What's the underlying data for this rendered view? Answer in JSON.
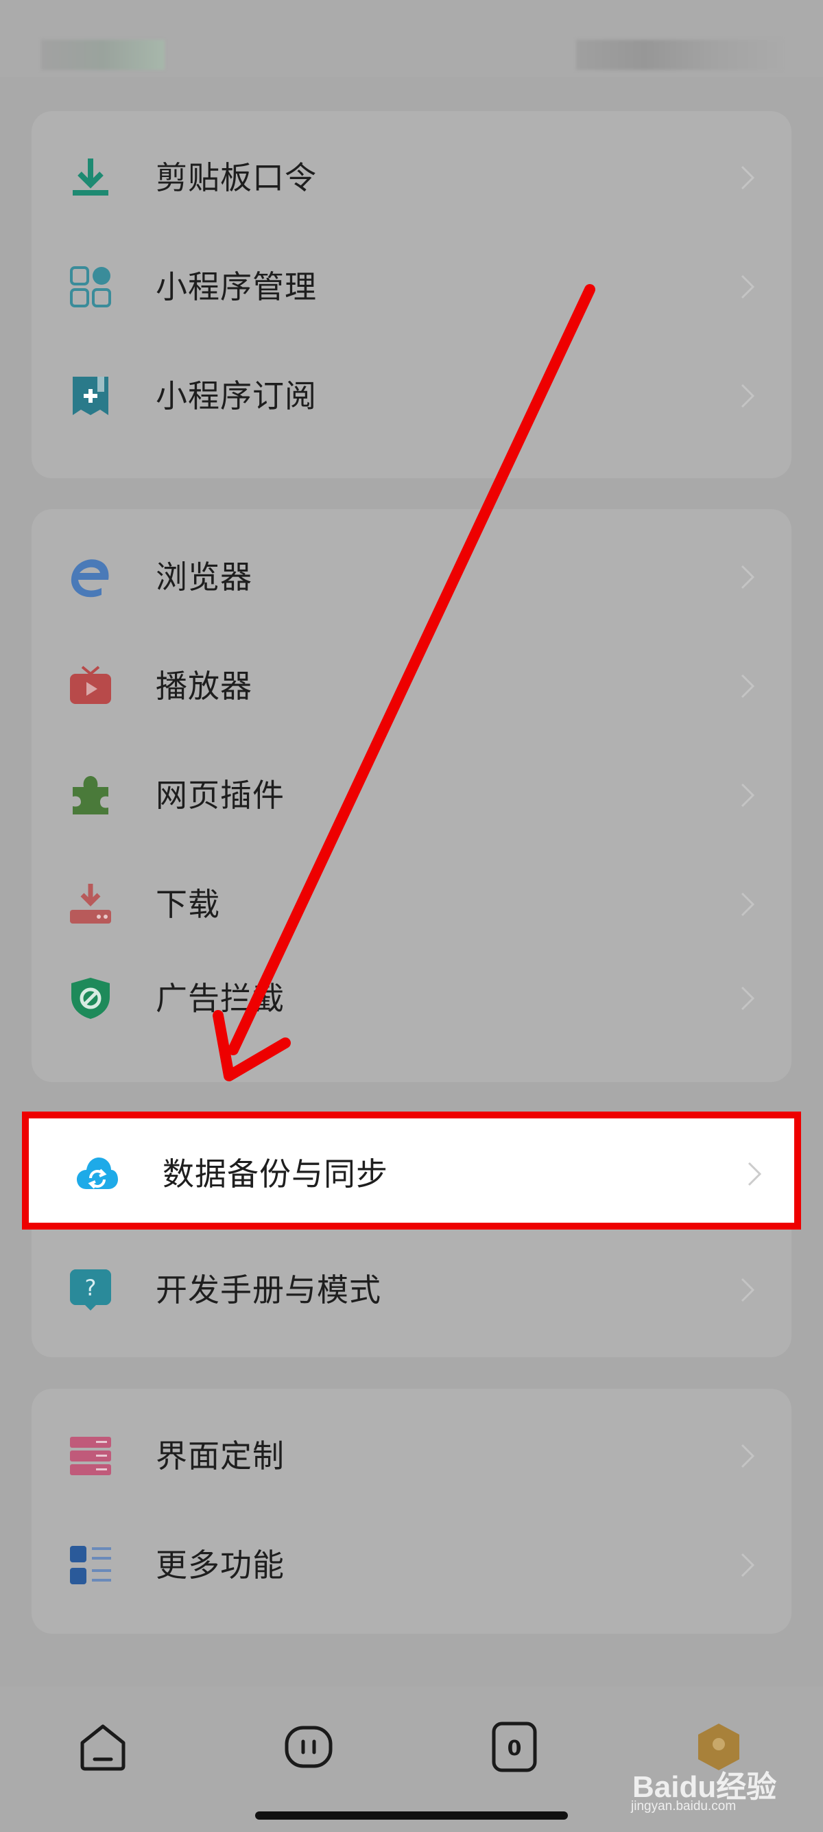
{
  "groups": [
    {
      "items": [
        {
          "label": "剪贴板口令",
          "icon": "download-tray-icon",
          "color": "#1e8a72"
        },
        {
          "label": "小程序管理",
          "icon": "apps-grid-icon",
          "color": "#3a8c9a"
        },
        {
          "label": "小程序订阅",
          "icon": "bookmark-plus-icon",
          "color": "#2a7a8a"
        }
      ]
    },
    {
      "items": [
        {
          "label": "浏览器",
          "icon": "browser-e-icon",
          "color": "#4a7ab8"
        },
        {
          "label": "播放器",
          "icon": "tv-play-icon",
          "color": "#b84a4a"
        },
        {
          "label": "网页插件",
          "icon": "puzzle-icon",
          "color": "#4a7a3a"
        },
        {
          "label": "下载",
          "icon": "download-drive-icon",
          "color": "#b85a5a"
        },
        {
          "label": "广告拦截",
          "icon": "shield-block-icon",
          "color": "#1e8a5a"
        }
      ]
    },
    {
      "items": [
        {
          "label": "数据备份与同步",
          "icon": "cloud-sync-icon",
          "color": "#1eaae8"
        },
        {
          "label": "开发手册与模式",
          "icon": "help-bubble-icon",
          "color": "#2a8a9a"
        }
      ]
    },
    {
      "items": [
        {
          "label": "界面定制",
          "icon": "layout-panels-icon",
          "color": "#c05a7a"
        },
        {
          "label": "更多功能",
          "icon": "list-more-icon",
          "color": "#2a5a9a"
        }
      ]
    }
  ],
  "tabbar": {
    "tabs": [
      {
        "icon": "home-icon"
      },
      {
        "icon": "multi-window-icon"
      },
      {
        "icon": "tab-count-icon",
        "count": "0"
      },
      {
        "icon": "profile-icon"
      }
    ]
  },
  "watermark": {
    "main": "Baidu经验",
    "sub": "jingyan.baidu.com"
  },
  "colors": {
    "annotation": "#ee0000",
    "highlight_bg": "#ffffff",
    "overlay_bg": "#a9a9a9"
  }
}
